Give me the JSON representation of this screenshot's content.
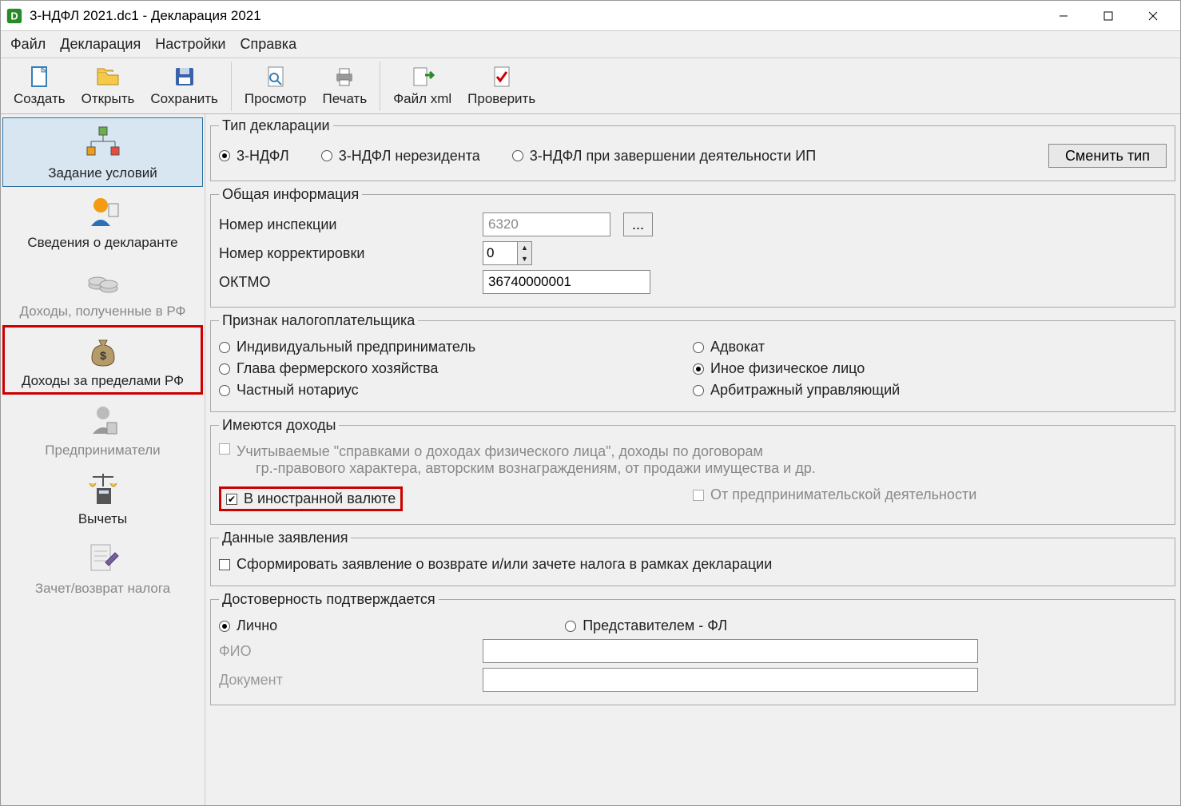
{
  "window": {
    "title": "3-НДФЛ 2021.dc1 - Декларация 2021"
  },
  "menu": {
    "file": "Файл",
    "decl": "Декларация",
    "settings": "Настройки",
    "help": "Справка"
  },
  "toolbar": {
    "create": "Создать",
    "open": "Открыть",
    "save": "Сохранить",
    "preview": "Просмотр",
    "print": "Печать",
    "xml": "Файл xml",
    "check": "Проверить"
  },
  "sidebar": {
    "items": [
      {
        "label": "Задание условий"
      },
      {
        "label": "Сведения о декларанте"
      },
      {
        "label": "Доходы, полученные в РФ"
      },
      {
        "label": "Доходы за пределами РФ"
      },
      {
        "label": "Предприниматели"
      },
      {
        "label": "Вычеты"
      },
      {
        "label": "Зачет/возврат налога"
      }
    ]
  },
  "type_group": {
    "legend": "Тип декларации",
    "opt1": "3-НДФЛ",
    "opt2": "3-НДФЛ нерезидента",
    "opt3": "3-НДФЛ при завершении деятельности ИП",
    "change": "Сменить тип"
  },
  "general": {
    "legend": "Общая информация",
    "inspection_lbl": "Номер инспекции",
    "inspection_val": "6320",
    "browse": "...",
    "corr_lbl": "Номер корректировки",
    "corr_val": "0",
    "oktmo_lbl": "ОКТМО",
    "oktmo_val": "36740000001"
  },
  "taxpayer": {
    "legend": "Признак налогоплательщика",
    "ip": "Индивидуальный предприниматель",
    "lawyer": "Адвокат",
    "farmer": "Глава фермерского хозяйства",
    "other": "Иное физическое лицо",
    "notary": "Частный нотариус",
    "arbitr": "Арбитражный управляющий"
  },
  "income": {
    "legend": "Имеются доходы",
    "spravki": "Учитываемые \"справками о доходах физического лица\", доходы по договорам",
    "spravki2": "гр.-правового характера, авторским вознаграждениям, от продажи имущества и др.",
    "foreign": "В иностранной валюте",
    "biz": "От предпринимательской деятельности"
  },
  "appdata": {
    "legend": "Данные заявления",
    "form_app": "Сформировать заявление о  возврате и/или зачете налога в рамках декларации"
  },
  "auth": {
    "legend": "Достоверность подтверждается",
    "self": "Лично",
    "rep": "Представителем - ФЛ",
    "fio_lbl": "ФИО",
    "doc_lbl": "Документ"
  }
}
